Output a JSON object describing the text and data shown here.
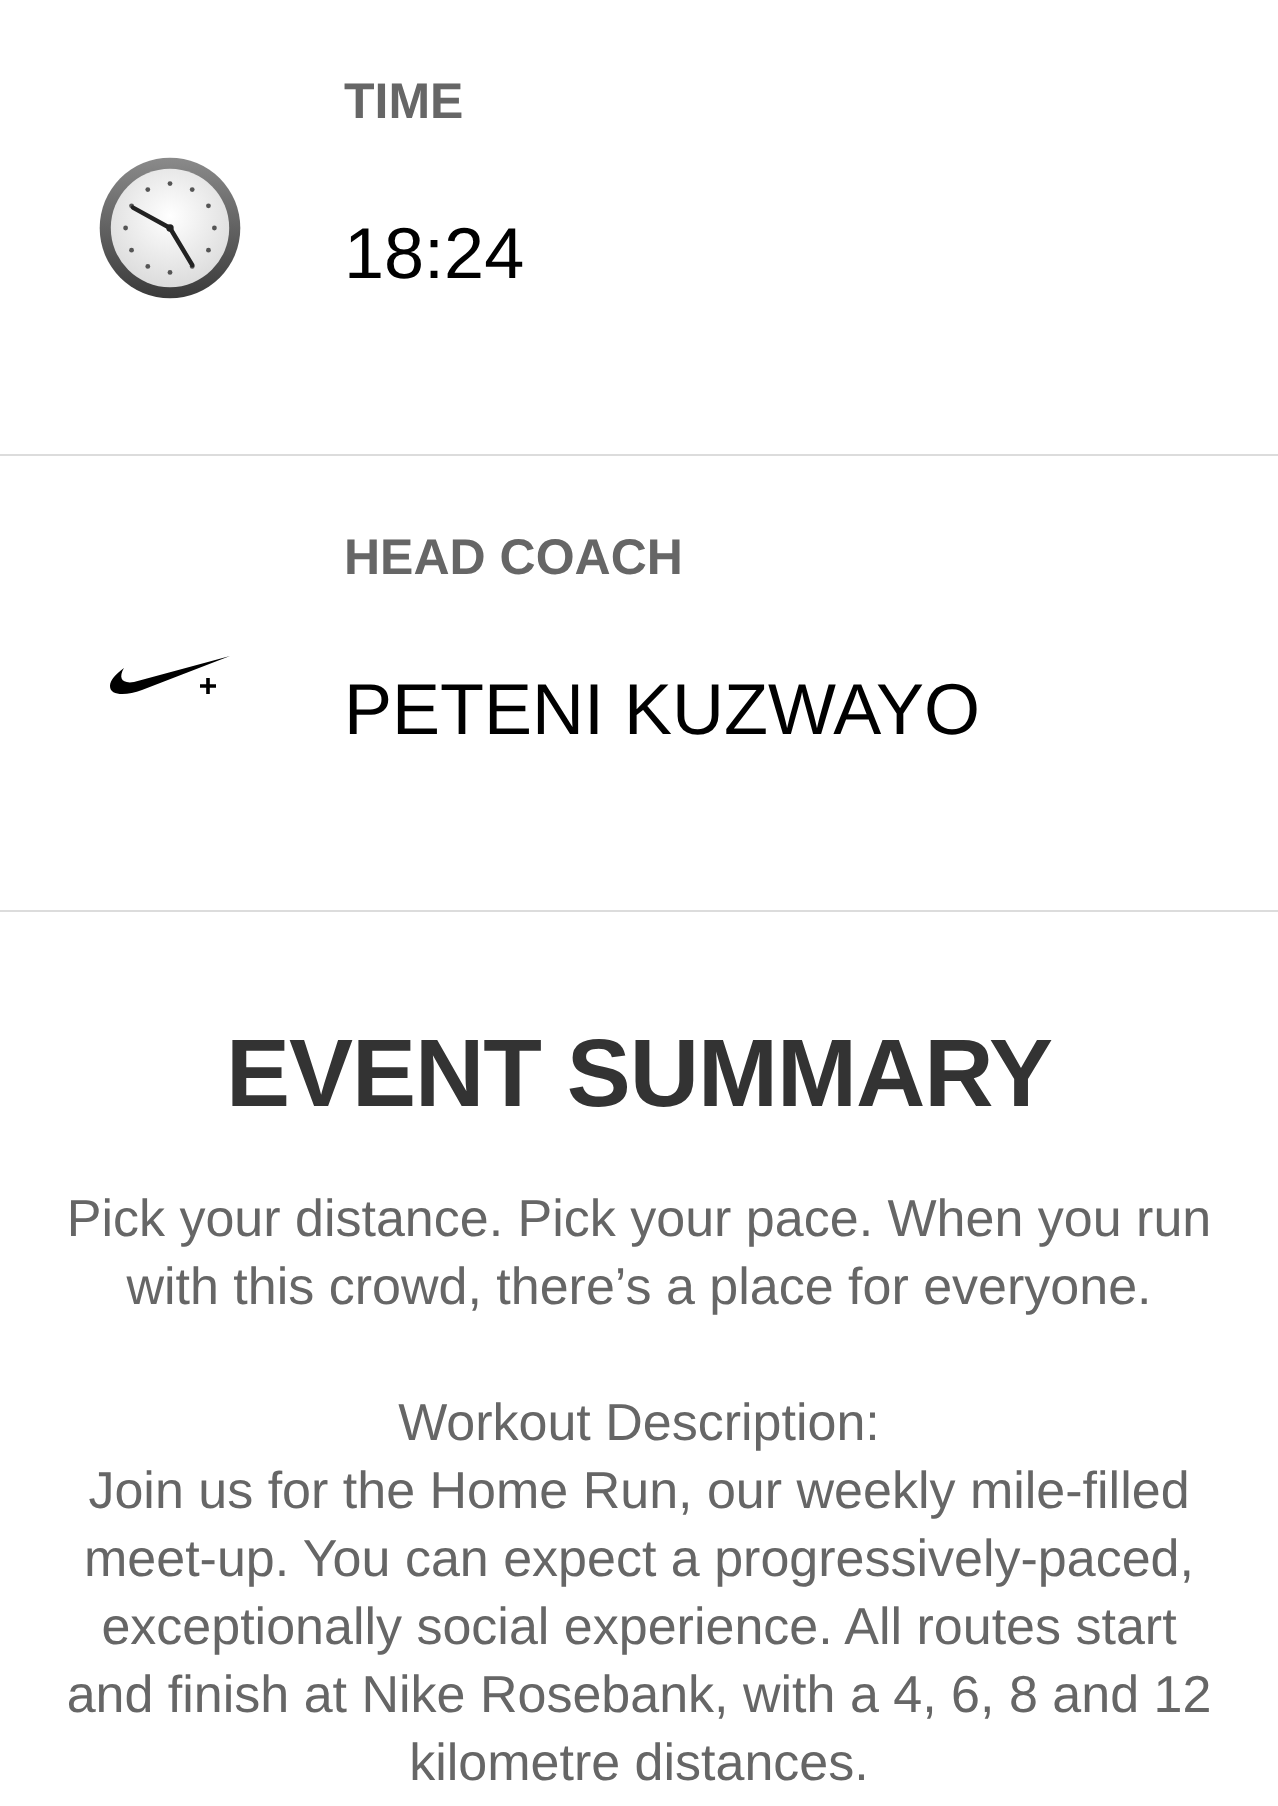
{
  "sections": [
    {
      "kind": "clock",
      "label": "TIME",
      "value": "18:24"
    },
    {
      "kind": "swoosh",
      "label": "HEAD COACH",
      "value": "PETENI KUZWAYO"
    }
  ],
  "summary": {
    "title": "EVENT SUMMARY",
    "intro": "Pick your distance. Pick your pace. When you run with this crowd, there’s a place for everyone.",
    "description_label": "Workout Description:",
    "description": "Join us for the Home Run, our weekly mile-filled meet-up. You can expect a progressively-paced, exceptionally social experience. All routes start and finish at Nike Rosebank, with a 4, 6, 8 and 12 kilometre distances."
  }
}
